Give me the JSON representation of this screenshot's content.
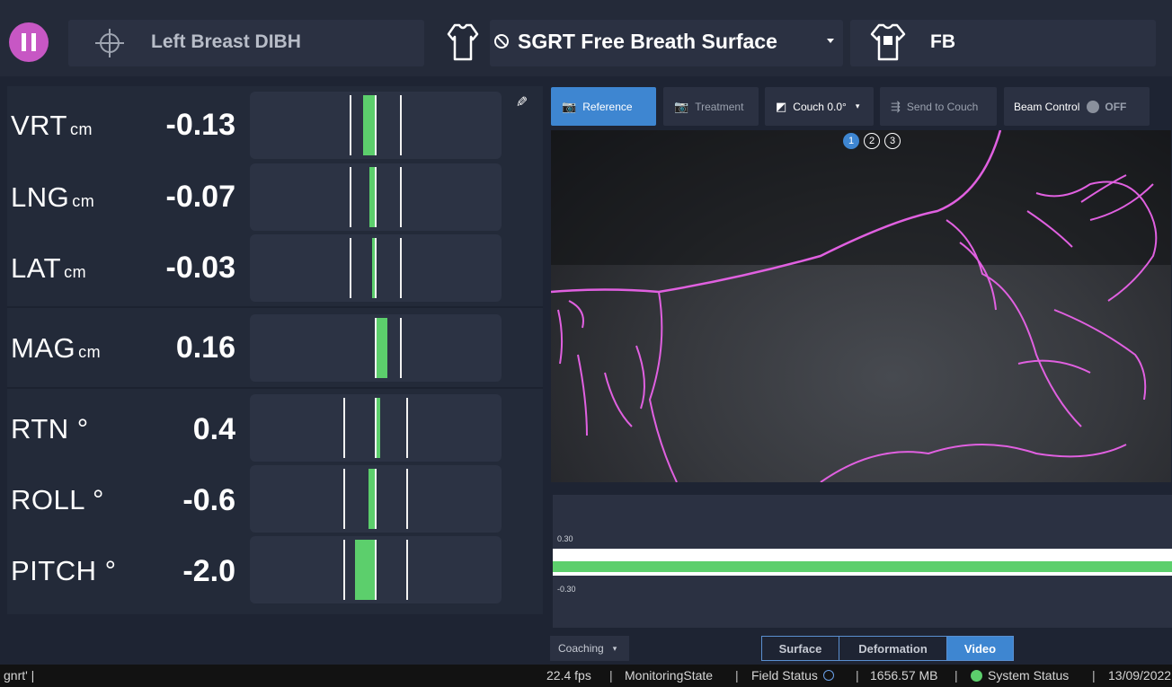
{
  "header": {
    "plan_name": "Left Breast DIBH",
    "surface_name": "SGRT Free Breath Surface",
    "reference_name": "FB",
    "colors": {
      "pause": "#c757c4",
      "accent": "#3e86d1",
      "bar": "#5ccf6c",
      "contour": "#e060e0"
    }
  },
  "metrics": [
    {
      "label": "VRT",
      "unit": "cm",
      "value": "-0.13"
    },
    {
      "label": "LNG",
      "unit": "cm",
      "value": "-0.07"
    },
    {
      "label": "LAT",
      "unit": "cm",
      "value": "-0.03"
    },
    {
      "label": "MAG",
      "unit": "cm",
      "value": "0.16"
    },
    {
      "label": "RTN",
      "unit": "°",
      "value": "0.4"
    },
    {
      "label": "ROLL",
      "unit": "°",
      "value": "-0.6"
    },
    {
      "label": "PITCH",
      "unit": "°",
      "value": "-2.0"
    }
  ],
  "toolbar": {
    "reference": "Reference",
    "treatment": "Treatment",
    "couch": "Couch 0.0°",
    "send_to_couch": "Send to Couch",
    "beam_control": "Beam Control",
    "beam_state": "OFF"
  },
  "camera_pages": [
    "1",
    "2",
    "3"
  ],
  "graph": {
    "upper": "0.30",
    "lower": "-0.30"
  },
  "bottom": {
    "coaching": "Coaching",
    "tabs": [
      "Surface",
      "Deformation",
      "Video"
    ],
    "active_tab": "Video"
  },
  "statusbar": {
    "left": "gnrt' |",
    "fps": "22.4 fps",
    "state": "MonitoringState",
    "field": "Field Status",
    "memory": "1656.57 MB",
    "system": "System Status",
    "date": "13/09/2022"
  }
}
